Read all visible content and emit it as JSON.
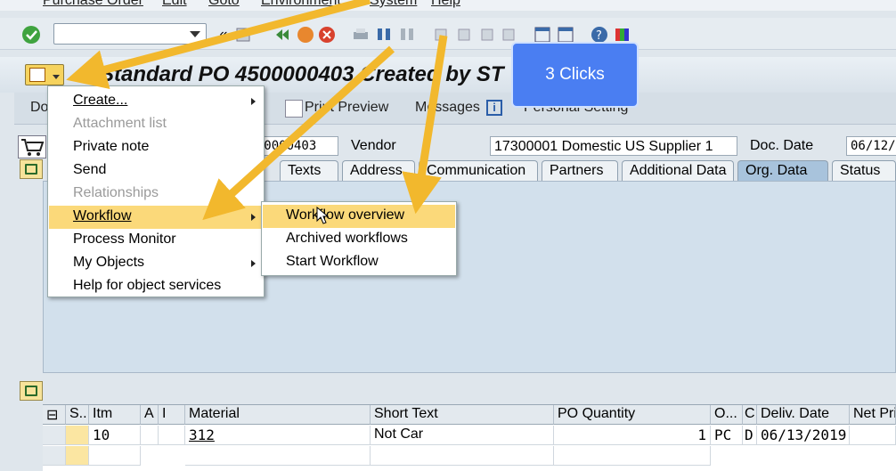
{
  "menubar": [
    "Purchase Order",
    "Edit",
    "Goto",
    "Environment",
    "System",
    "Help"
  ],
  "toolbar": {
    "command_value": "",
    "chevrons": "«"
  },
  "title": "Standard PO 4500000403 Created by ST",
  "app_toolbar": {
    "document_overview": "Do",
    "print_preview": "Print Preview",
    "messages": "Messages",
    "personal_setting": "Personal Setting"
  },
  "header": {
    "po_number": "4500000403",
    "vendor_label": "Vendor",
    "vendor_value": "17300001 Domestic US Supplier 1",
    "doc_date_label": "Doc. Date",
    "doc_date_value": "06/12/"
  },
  "tabs": [
    "Texts",
    "Address",
    "Communication",
    "Partners",
    "Additional Data",
    "Org. Data",
    "Status"
  ],
  "active_tab": "Org. Data",
  "menu": {
    "items": [
      {
        "label": "Create...",
        "disabled": false,
        "submenu": true
      },
      {
        "label": "Attachment list",
        "disabled": true,
        "submenu": false
      },
      {
        "label": "Private note",
        "disabled": false,
        "submenu": false
      },
      {
        "label": "Send",
        "disabled": false,
        "submenu": false
      },
      {
        "label": "Relationships",
        "disabled": true,
        "submenu": false
      },
      {
        "label": "Workflow",
        "disabled": false,
        "submenu": true,
        "highlighted": true
      },
      {
        "label": "Process Monitor",
        "disabled": false,
        "submenu": false
      },
      {
        "label": "My Objects",
        "disabled": false,
        "submenu": true
      },
      {
        "label": "Help for object services",
        "disabled": false,
        "submenu": false
      }
    ]
  },
  "submenu": {
    "items": [
      {
        "label": "Workflow overview",
        "highlighted": true
      },
      {
        "label": "Archived workflows",
        "highlighted": false
      },
      {
        "label": "Start Workflow",
        "highlighted": false
      }
    ]
  },
  "callout": "3 Clicks",
  "grid": {
    "headers": [
      "S...",
      "Itm",
      "A",
      "I",
      "Material",
      "Short Text",
      "PO Quantity",
      "O...",
      "C",
      "Deliv. Date",
      "Net Pri"
    ],
    "rows": [
      {
        "itm": "10",
        "material": "312",
        "short_text": "Not Car",
        "po_qty": "1",
        "unit": "PC",
        "c": "D",
        "deliv_date": "06/13/2019"
      }
    ]
  },
  "colors": {
    "highlight": "#fbd97a",
    "callout": "#4a7ef2",
    "annotation_arrow": "#f2b82d"
  }
}
